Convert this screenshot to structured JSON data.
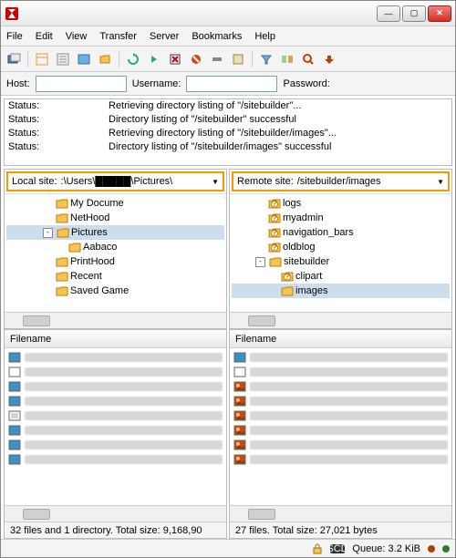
{
  "menu": {
    "file": "File",
    "edit": "Edit",
    "view": "View",
    "transfer": "Transfer",
    "server": "Server",
    "bookmarks": "Bookmarks",
    "help": "Help"
  },
  "conn": {
    "host_label": "Host:",
    "host": "",
    "user_label": "Username:",
    "user": "",
    "pass_label": "Password:",
    "pass": ""
  },
  "log": [
    {
      "k": "Status:",
      "v": "Retrieving directory listing of \"/sitebuilder\"..."
    },
    {
      "k": "Status:",
      "v": "Directory listing of \"/sitebuilder\" successful"
    },
    {
      "k": "Status:",
      "v": "Retrieving directory listing of \"/sitebuilder/images\"..."
    },
    {
      "k": "Status:",
      "v": "Directory listing of \"/sitebuilder/images\" successful"
    }
  ],
  "local": {
    "label": "Local site:",
    "path": ":\\Users\\█████\\Pictures\\",
    "tree": [
      {
        "indent": 54,
        "name": "My Docume",
        "icon": "folder"
      },
      {
        "indent": 54,
        "name": "NetHood",
        "icon": "folder"
      },
      {
        "indent": 40,
        "name": "Pictures",
        "icon": "folder",
        "exp": "-",
        "sel": true
      },
      {
        "indent": 68,
        "name": "Aabaco",
        "icon": "folder"
      },
      {
        "indent": 54,
        "name": "PrintHood",
        "icon": "folder"
      },
      {
        "indent": 54,
        "name": "Recent",
        "icon": "folder"
      },
      {
        "indent": 54,
        "name": "Saved Game",
        "icon": "folder"
      }
    ],
    "hdr": "Filename",
    "files": [
      {
        "icon": "img"
      },
      {
        "icon": "file"
      },
      {
        "icon": "img"
      },
      {
        "icon": "img"
      },
      {
        "icon": "doc"
      },
      {
        "icon": "img"
      },
      {
        "icon": "img"
      },
      {
        "icon": "img"
      }
    ],
    "status": "32 files and 1 directory. Total size: 9,168,90"
  },
  "remote": {
    "label": "Remote site:",
    "path": "/sitebuilder/images",
    "tree": [
      {
        "indent": 40,
        "name": "logs",
        "icon": "qfolder"
      },
      {
        "indent": 40,
        "name": "myadmin",
        "icon": "qfolder"
      },
      {
        "indent": 40,
        "name": "navigation_bars",
        "icon": "qfolder"
      },
      {
        "indent": 40,
        "name": "oldblog",
        "icon": "qfolder"
      },
      {
        "indent": 26,
        "name": "sitebuilder",
        "icon": "folder",
        "exp": "-"
      },
      {
        "indent": 54,
        "name": "clipart",
        "icon": "qfolder"
      },
      {
        "indent": 54,
        "name": "images",
        "icon": "folder",
        "sel": true
      }
    ],
    "hdr": "Filename",
    "files": [
      {
        "icon": "img"
      },
      {
        "icon": "file"
      },
      {
        "icon": "pic"
      },
      {
        "icon": "pic"
      },
      {
        "icon": "pic"
      },
      {
        "icon": "pic"
      },
      {
        "icon": "pic"
      },
      {
        "icon": "pic"
      }
    ],
    "status": "27 files. Total size: 27,021 bytes"
  },
  "footer": {
    "queue_label": "Queue: 3.2 KiB"
  },
  "icons": {
    "folder_hex": "#f5c452",
    "qmark": "#c08000",
    "img_hex": "#3a8fc4",
    "pic_hex": "#d04810",
    "doc_hex": "#ffffff"
  }
}
